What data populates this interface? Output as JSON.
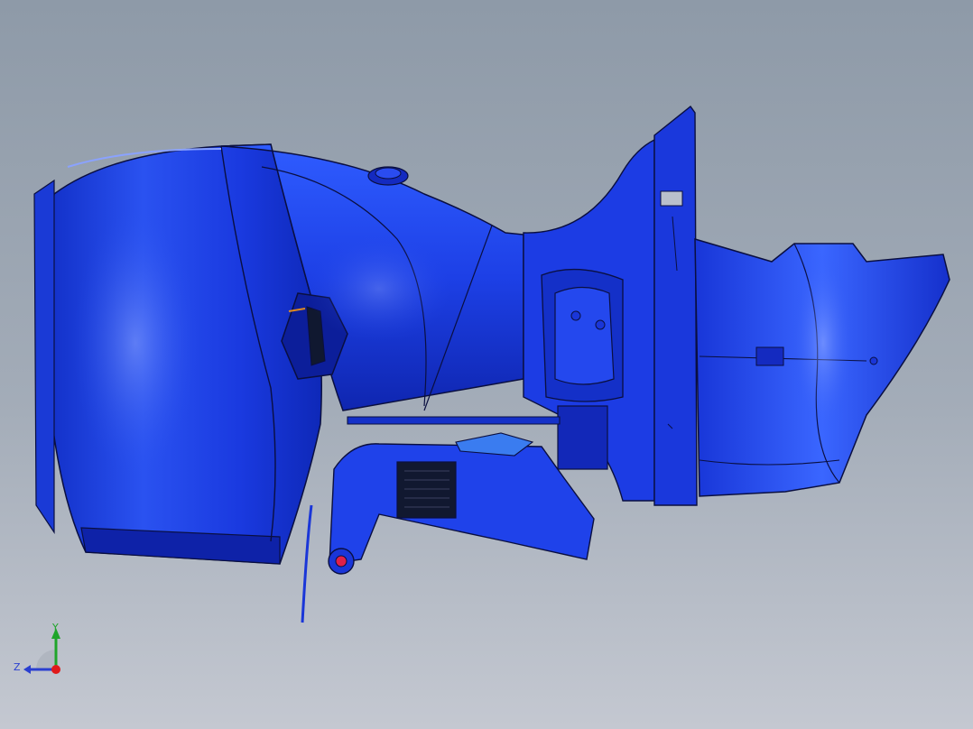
{
  "viewport": {
    "background_top": "#8e9aa8",
    "background_bottom": "#c4c8d1"
  },
  "model": {
    "body_color": "#1f3fe0",
    "highlight_color": "#6f8cff",
    "shadow_color": "#0a1a9c",
    "edge_color": "#0a0f40",
    "accent_red": "#e0204a"
  },
  "triad": {
    "y_label": "Y",
    "z_label": "Z",
    "y_color": "#1fa52a",
    "z_color": "#2a3fd0",
    "x_color": "#e01a1a"
  }
}
